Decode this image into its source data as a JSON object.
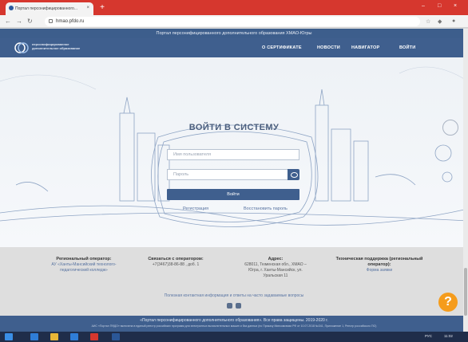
{
  "browser": {
    "tab_title": "Портал персонифицированного...",
    "new_tab_label": "+",
    "url": "hmao.pfdo.ru",
    "window_controls": [
      "–",
      "□",
      "×"
    ],
    "nav_icons": [
      "arrow-left-icon",
      "arrow-right-icon",
      "reload-icon"
    ]
  },
  "site": {
    "portal_title": "Портал персонифицированного дополнительного образования ХМАО-Югры",
    "logo_text": "персонифицированное дополнительное образование",
    "nav": [
      "О СЕРТИФИКАТЕ",
      "НОВОСТИ",
      "НАВИГАТОР",
      "ВОЙТИ"
    ]
  },
  "login": {
    "title": "ВОЙТИ В СИСТЕМУ",
    "username_placeholder": "Имя пользователя",
    "password_placeholder": "Пароль",
    "submit_label": "Войти",
    "register_link": "Регистрация",
    "restore_link": "Восстановить пароль"
  },
  "footer": {
    "regional_operator": {
      "heading": "Региональный оператор:",
      "text": "АУ «Ханты-Мансийский технолого-педагогический колледж»"
    },
    "contact": {
      "heading": "Связаться с оператором:",
      "text": "+7(3467)38-86-88 , доб. 1"
    },
    "address": {
      "heading": "Адрес:",
      "text": "628011, Тюменская обл., ХМАО – Югра, г. Ханты-Мансийск, ул. Уральская 11"
    },
    "support": {
      "heading": "Техническая поддержка (региональный оператор):",
      "link": "Форма заявки"
    },
    "note": "Полезная контактная информация и ответы на часто задаваемые вопросы",
    "copyright": "«Портал персонифицированного дополнительного образования». Все права защищены. 2019-2020 г.",
    "disclaimer": "АИС «Портал ПФДО» включена в единый реестр российских программ для электронных вычислительных машин и баз данных (по Приказу Минкомсвязи РФ от 10.07.2018 №341, Приложение 1, Реестр российского ПО)",
    "help_label": "?"
  },
  "taskbar": {
    "tray_lang": "РУС",
    "tray_time": "11:02",
    "icons": [
      "windows-start-icon",
      "edge-icon",
      "file-explorer-icon",
      "store-icon",
      "chrome-icon",
      "word-icon"
    ]
  },
  "colors": {
    "chrome_red": "#d6372e",
    "site_blue": "#3f5f8e",
    "help_orange": "#f59c1c"
  }
}
